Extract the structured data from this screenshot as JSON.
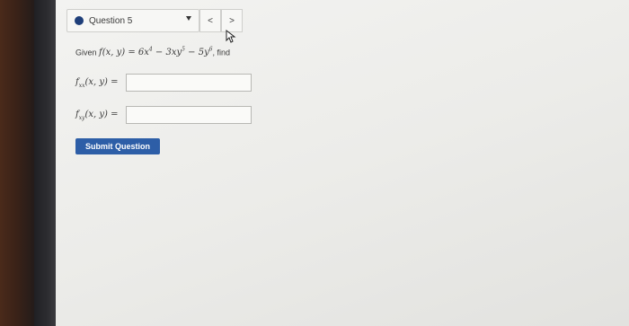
{
  "question_selector": {
    "label": "Question 5"
  },
  "nav": {
    "prev_label": "<",
    "next_label": ">"
  },
  "problem": {
    "prefix": "Given",
    "function": "f(x, y) = 6x",
    "exp1": "4",
    "term2": " − 3xy",
    "exp2": "5",
    "term3": " − 5y",
    "exp3": "6",
    "suffix": ", find"
  },
  "answers": [
    {
      "label_fn": "f",
      "label_sub": "xx",
      "label_args": "(x, y) =",
      "value": ""
    },
    {
      "label_fn": "f",
      "label_sub": "xy",
      "label_args": "(x, y) =",
      "value": ""
    }
  ],
  "submit": {
    "label": "Submit Question"
  },
  "colors": {
    "accent": "#2d5ea7",
    "dot": "#1f3f7a"
  }
}
